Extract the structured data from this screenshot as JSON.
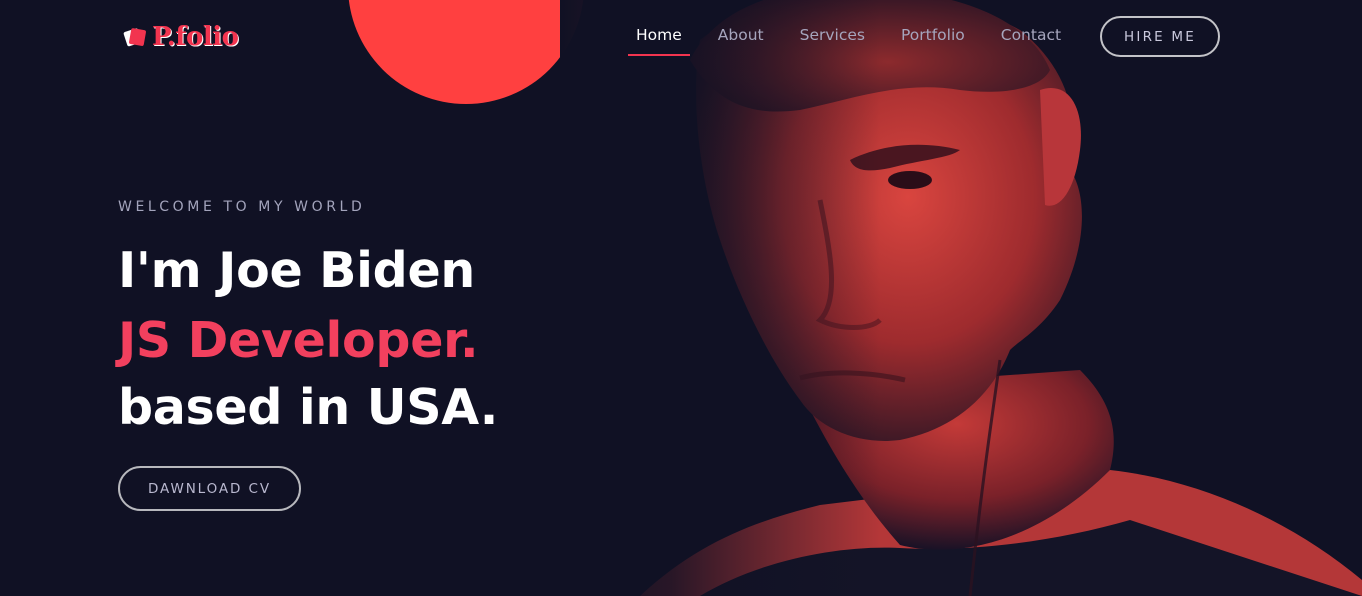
{
  "header": {
    "logo_text": "P.folio",
    "nav": [
      {
        "label": "Home",
        "active": true
      },
      {
        "label": "About",
        "active": false
      },
      {
        "label": "Services",
        "active": false
      },
      {
        "label": "Portfolio",
        "active": false
      },
      {
        "label": "Contact",
        "active": false
      }
    ],
    "hire_label": "HIRE ME"
  },
  "hero": {
    "welcome": "WELCOME TO MY WORLD",
    "line1": "I'm Joe Biden",
    "line2": "JS Developer.",
    "line3": "based in USA.",
    "cv_label": "DAWNLOAD CV"
  },
  "colors": {
    "background": "#101124",
    "accent": "#f2344f",
    "nav_text": "#a6a5bd"
  },
  "icons": {
    "logo": "tilted-rectangle-logo-icon"
  }
}
